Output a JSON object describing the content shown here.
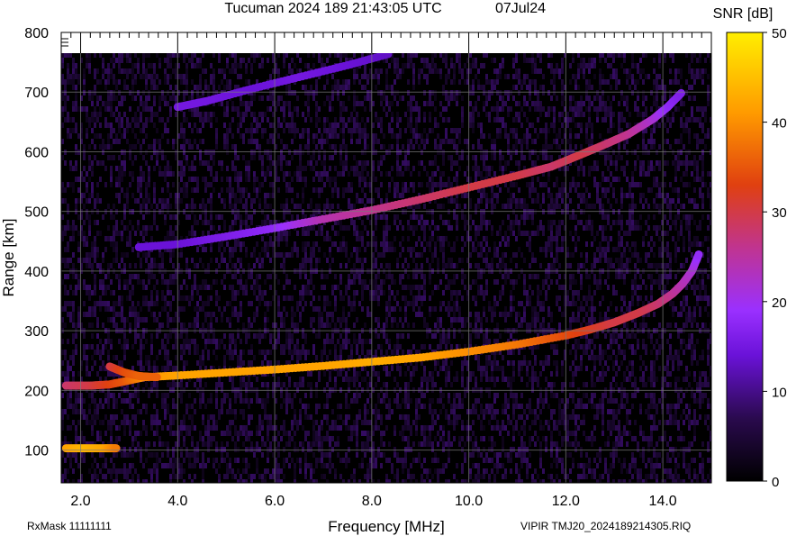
{
  "header": {
    "title": "Tucuman 2024 189 21:43:05 UTC",
    "date": "07Jul24"
  },
  "footer": {
    "left": "RxMask 11111111",
    "right": "VIPIR  TMJ20_2024189214305.RIQ"
  },
  "chart_data": {
    "type": "heatmap",
    "title": "Tucuman 2024 189 21:43:05 UTC",
    "xlabel": "Frequency [MHz]",
    "ylabel": "Range [km]",
    "xlim": [
      1.6,
      15.0
    ],
    "ylim": [
      45,
      800
    ],
    "x_ticks": [
      2.0,
      4.0,
      6.0,
      8.0,
      10.0,
      12.0,
      14.0
    ],
    "x_tick_labels": [
      "2.0",
      "4.0",
      "6.0",
      "8.0",
      "10.0",
      "12.0",
      "14.0"
    ],
    "y_ticks": [
      100,
      200,
      300,
      400,
      500,
      600,
      700,
      800
    ],
    "y_tick_labels": [
      "100",
      "200",
      "300",
      "400",
      "500",
      "600",
      "700",
      "800"
    ],
    "grid": true,
    "colorbar": {
      "label": "SNR [dB]",
      "range": [
        0,
        50
      ],
      "ticks": [
        0,
        10,
        20,
        30,
        40,
        50
      ],
      "tick_labels": [
        "0",
        "10",
        "20",
        "30",
        "40",
        "50"
      ],
      "colors": [
        "#000000",
        "#2a0a4e",
        "#6a12d8",
        "#9a30ff",
        "#c03490",
        "#e04010",
        "#ff9a00",
        "#ffee00"
      ]
    },
    "traces": [
      {
        "name": "",
        "points": [
          [
            1.7,
            103
          ],
          [
            2.1,
            103
          ],
          [
            2.5,
            103
          ],
          [
            2.75,
            103
          ]
        ],
        "snr": [
          42,
          44,
          42,
          38
        ]
      },
      {
        "name": "",
        "points": [
          [
            1.7,
            208
          ],
          [
            2.2,
            208
          ],
          [
            2.6,
            210
          ],
          [
            2.9,
            215
          ],
          [
            3.3,
            222
          ],
          [
            4,
            225
          ],
          [
            5,
            230
          ],
          [
            6,
            235
          ],
          [
            7,
            241
          ],
          [
            8,
            248
          ],
          [
            9,
            255
          ],
          [
            10,
            265
          ],
          [
            11,
            277
          ],
          [
            12,
            292
          ],
          [
            12.5,
            302
          ],
          [
            13,
            314
          ],
          [
            13.5,
            330
          ],
          [
            13.9,
            345
          ],
          [
            14.2,
            362
          ],
          [
            14.4,
            378
          ],
          [
            14.6,
            400
          ],
          [
            14.75,
            430
          ]
        ],
        "snr": [
          28,
          30,
          33,
          35,
          40,
          42,
          42,
          42,
          42,
          43,
          42,
          40,
          38,
          34,
          32,
          30,
          30,
          28,
          26,
          24,
          22,
          18
        ]
      },
      {
        "name": "",
        "points": [
          [
            2.6,
            240
          ],
          [
            2.9,
            230
          ],
          [
            3.2,
            224
          ],
          [
            3.6,
            222
          ]
        ],
        "snr": [
          30,
          34,
          36,
          36
        ]
      },
      {
        "name": "",
        "points": [
          [
            3.2,
            440
          ],
          [
            4,
            445
          ],
          [
            5,
            458
          ],
          [
            6,
            472
          ],
          [
            7,
            487
          ],
          [
            8,
            502
          ],
          [
            9,
            520
          ],
          [
            10,
            540
          ],
          [
            11,
            560
          ],
          [
            11.7,
            575
          ],
          [
            12.3,
            595
          ],
          [
            12.8,
            612
          ],
          [
            13.3,
            630
          ],
          [
            13.8,
            655
          ],
          [
            14.1,
            675
          ],
          [
            14.4,
            700
          ]
        ],
        "snr": [
          14,
          14,
          16,
          18,
          24,
          26,
          28,
          30,
          30,
          28,
          30,
          28,
          26,
          22,
          18,
          16
        ]
      },
      {
        "name": "",
        "points": [
          [
            4,
            675
          ],
          [
            4.6,
            685
          ],
          [
            5.5,
            705
          ],
          [
            6.5,
            725
          ],
          [
            7.5,
            745
          ],
          [
            8.4,
            765
          ]
        ],
        "snr": [
          15,
          15,
          14,
          15,
          14,
          13
        ]
      }
    ]
  }
}
